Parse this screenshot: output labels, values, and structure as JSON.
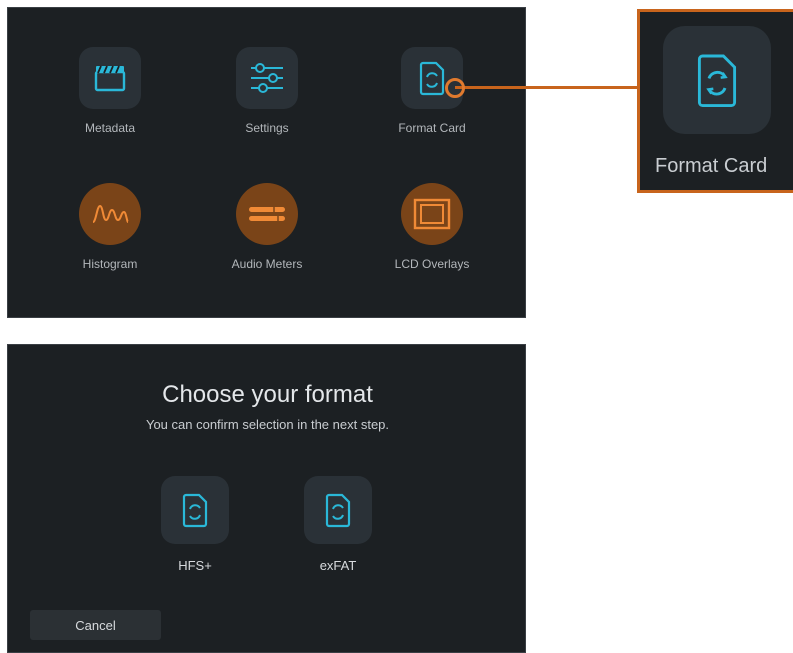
{
  "menu": {
    "items": [
      {
        "label": "Metadata",
        "icon": "clapperboard-icon"
      },
      {
        "label": "Settings",
        "icon": "sliders-icon"
      },
      {
        "label": "Format Card",
        "icon": "format-card-icon"
      },
      {
        "label": "Histogram",
        "icon": "histogram-icon"
      },
      {
        "label": "Audio Meters",
        "icon": "audio-meters-icon"
      },
      {
        "label": "LCD Overlays",
        "icon": "lcd-overlays-icon"
      }
    ]
  },
  "callout": {
    "label": "Format Card",
    "icon": "format-card-icon"
  },
  "format_dialog": {
    "title": "Choose your format",
    "subtitle": "You can confirm selection in the next step.",
    "options": [
      {
        "label": "HFS+",
        "icon": "format-card-icon"
      },
      {
        "label": "exFAT",
        "icon": "format-card-icon"
      }
    ],
    "cancel_label": "Cancel"
  },
  "colors": {
    "accent_blue": "#2ab8d8",
    "accent_orange": "#e07a2e",
    "panel_bg": "#1c2023"
  }
}
